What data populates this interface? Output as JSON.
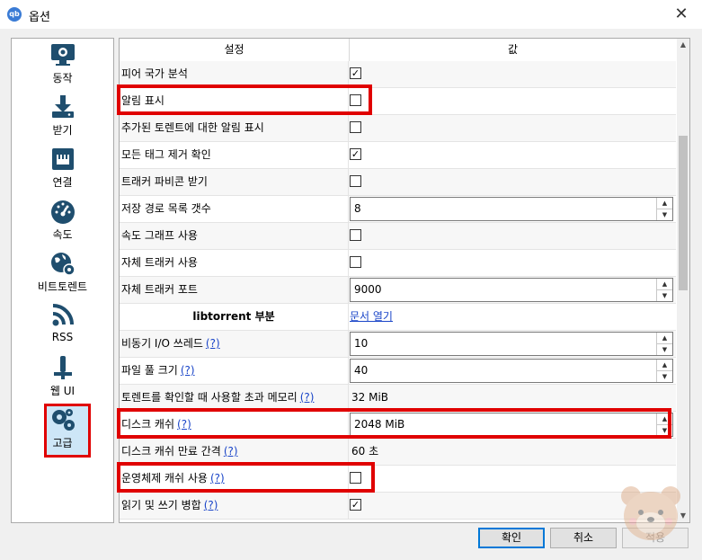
{
  "window": {
    "title": "옵션",
    "app_icon_text": "qb"
  },
  "sidebar": {
    "items": [
      {
        "label": "동작",
        "icon": "monitor-gear-icon"
      },
      {
        "label": "받기",
        "icon": "download-icon"
      },
      {
        "label": "연결",
        "icon": "network-port-icon"
      },
      {
        "label": "속도",
        "icon": "speedometer-icon"
      },
      {
        "label": "비트토렌트",
        "icon": "globe-gear-icon"
      },
      {
        "label": "RSS",
        "icon": "rss-icon"
      },
      {
        "label": "웹 UI",
        "icon": "plug-icon"
      },
      {
        "label": "고급",
        "icon": "gears-icon",
        "selected": true
      }
    ]
  },
  "table": {
    "header_setting": "설정",
    "header_value": "값",
    "rows": [
      {
        "label": "피어 국가 분석",
        "type": "checkbox",
        "checked": "✓"
      },
      {
        "label": "알림 표시",
        "type": "checkbox",
        "checked": ""
      },
      {
        "label": "추가된 토렌트에 대한 알림 표시",
        "type": "checkbox",
        "checked": ""
      },
      {
        "label": "모든 태그 제거 확인",
        "type": "checkbox",
        "checked": "✓"
      },
      {
        "label": "트래커 파비콘 받기",
        "type": "checkbox",
        "checked": ""
      },
      {
        "label": "저장 경로 목록 갯수",
        "type": "spin",
        "value": "8"
      },
      {
        "label": "속도 그래프 사용",
        "type": "checkbox",
        "checked": ""
      },
      {
        "label": "자체 트래커 사용",
        "type": "checkbox",
        "checked": ""
      },
      {
        "label": "자체 트래커 포트",
        "type": "spin",
        "value": "9000"
      },
      {
        "label": "libtorrent 부분",
        "type": "link",
        "value": "문서 열기"
      },
      {
        "label": "비동기 I/O 쓰레드",
        "help": "(?)",
        "type": "spin",
        "value": "10"
      },
      {
        "label": "파일 풀 크기",
        "help": "(?)",
        "type": "spin",
        "value": "40"
      },
      {
        "label": "토렌트를 확인할 때 사용할 초과 메모리",
        "help": "(?)",
        "type": "text",
        "value": "32 MiB"
      },
      {
        "label": "디스크 캐쉬",
        "help": "(?)",
        "type": "spin",
        "value": "2048 MiB"
      },
      {
        "label": "디스크 캐쉬 만료 간격",
        "help": "(?)",
        "type": "text",
        "value": "60 초"
      },
      {
        "label": "운영체제 캐쉬 사용",
        "help": "(?)",
        "type": "checkbox",
        "checked": ""
      },
      {
        "label": "읽기 및 쓰기 병합",
        "help": "(?)",
        "type": "checkbox",
        "checked": "✓"
      }
    ]
  },
  "buttons": {
    "ok": "확인",
    "cancel": "취소",
    "apply": "적용"
  },
  "colors": {
    "highlight": "#e00000",
    "accent": "#0078d7",
    "link": "#1a45c8",
    "icon": "#1f4e6e"
  }
}
